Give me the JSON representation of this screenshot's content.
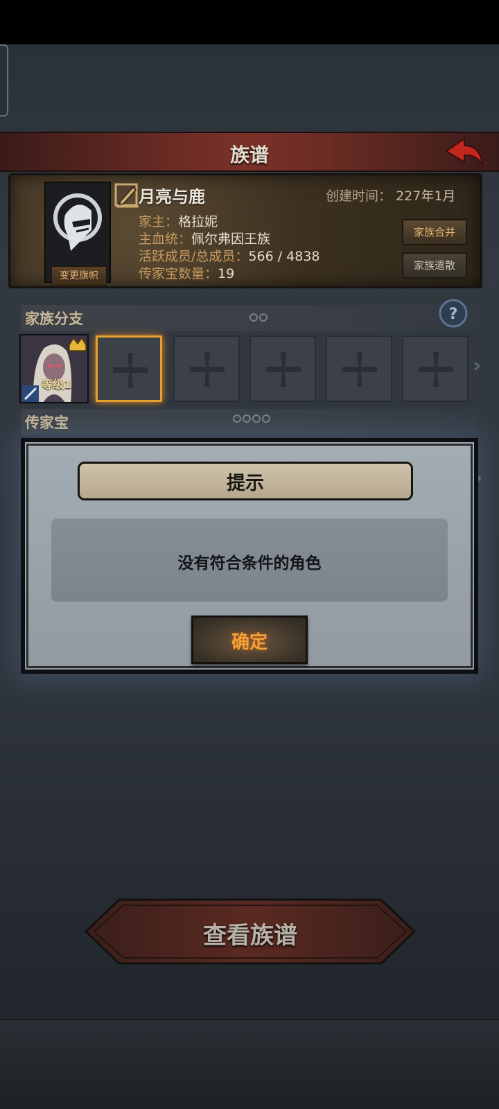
{
  "header": {
    "title": "族谱"
  },
  "family": {
    "name": "月亮与鹿",
    "created_label": "创建时间：",
    "created_value": "227年1月",
    "leader_label": "家主：",
    "leader_value": "格拉妮",
    "bloodline_label": "主血统：",
    "bloodline_value": "佩尔弗因王族",
    "members_label": "活跃成员/总成员：",
    "members_value": "566 / 4838",
    "heirloom_label": "传家宝数量：",
    "heirloom_value": "19",
    "change_flag_label": "变更旗帜",
    "merge_label": "家族合并",
    "disband_label": "家族遣散"
  },
  "branches": {
    "title": "家族分支",
    "hero_level": "等级1",
    "empty_slots": 5,
    "selected_slot": 1
  },
  "heirlooms": {
    "title": "传家宝"
  },
  "modal": {
    "title": "提示",
    "message": "没有符合条件的角色",
    "confirm_label": "确定"
  },
  "footer": {
    "view_tree_label": "查看族谱"
  },
  "colors": {
    "accent": "#e4a12d",
    "title_red": "#7a3128",
    "confirm": "#f3a13a"
  }
}
